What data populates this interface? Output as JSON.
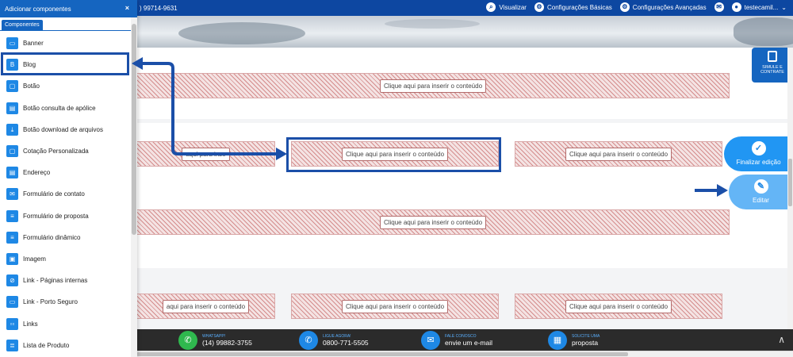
{
  "topbar": {
    "phone": ") 99714-9631",
    "nav": [
      {
        "label": "Visualizar",
        "icon": "search-icon"
      },
      {
        "label": "Configurações Básicas",
        "icon": "gear-icon"
      },
      {
        "label": "Configurações Avançadas",
        "icon": "gears-icon"
      },
      {
        "label": "",
        "icon": "mail-icon"
      },
      {
        "label": "testecamil...",
        "icon": "user-icon"
      }
    ]
  },
  "panel": {
    "title": "Adicionar componentes",
    "close": "×",
    "tab": "Componentes",
    "items": [
      {
        "label": "Banner",
        "icon": "banner-icon"
      },
      {
        "label": "Blog",
        "icon": "blog-icon"
      },
      {
        "label": "Botão",
        "icon": "button-icon"
      },
      {
        "label": "Botão consulta de apólice",
        "icon": "policy-button-icon"
      },
      {
        "label": "Botão download de arquivos",
        "icon": "download-icon"
      },
      {
        "label": "Cotação Personalizada",
        "icon": "quote-icon"
      },
      {
        "label": "Endereço",
        "icon": "address-icon"
      },
      {
        "label": "Formulário de contato",
        "icon": "mail-form-icon"
      },
      {
        "label": "Formulário de proposta",
        "icon": "proposal-form-icon"
      },
      {
        "label": "Formulário dinâmico",
        "icon": "dynamic-form-icon"
      },
      {
        "label": "Imagem",
        "icon": "image-icon"
      },
      {
        "label": "Link - Páginas internas",
        "icon": "link-internal-icon"
      },
      {
        "label": "Link - Porto Seguro",
        "icon": "link-porto-icon"
      },
      {
        "label": "Links",
        "icon": "links-icon"
      },
      {
        "label": "Lista de Produto",
        "icon": "product-list-icon"
      }
    ]
  },
  "content": {
    "placeholder": "Clique aqui para inserir o conteúdo",
    "placeholder_partial": "aqui para inserir o conteúdo",
    "placeholder_cut": "aqui para inse"
  },
  "simule": {
    "label1": "SIMULE E",
    "label2": "CONTRATE"
  },
  "fabs": {
    "finalizar": "Finalizar edição",
    "editar": "Editar"
  },
  "footer": {
    "items": [
      {
        "small": "WHATSAPP!",
        "big": "(14) 99882-3755",
        "icon": "whatsapp-icon",
        "color": "#2fb84e"
      },
      {
        "small": "LIGUE AGORA!",
        "big": "0800-771-5505",
        "icon": "phone-icon",
        "color": "#1e88e5"
      },
      {
        "small": "FALE CONOSCO",
        "big": "envie um e-mail",
        "icon": "envelope-icon",
        "color": "#1e88e5"
      },
      {
        "small": "SOLICITE UMA",
        "big": "proposta",
        "icon": "calculator-icon",
        "color": "#1e88e5"
      }
    ],
    "scroll_top": "∧"
  },
  "colors": {
    "brand": "#1565c0",
    "annotation": "#1b4fa8",
    "accent": "#2196f3"
  }
}
